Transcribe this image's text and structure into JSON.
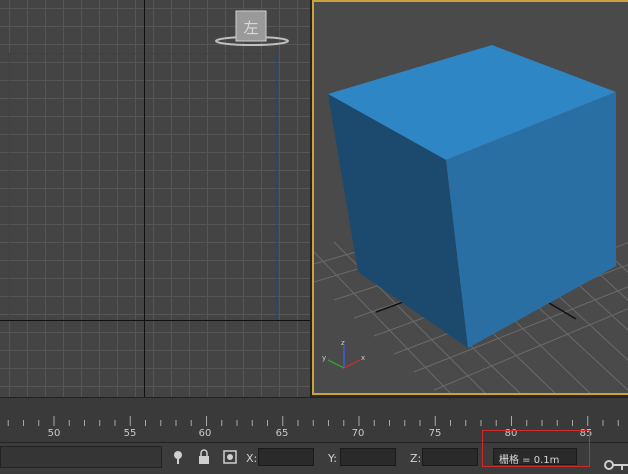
{
  "timeline": {
    "labels": [
      "50",
      "55",
      "60",
      "65",
      "70",
      "75",
      "80",
      "85"
    ]
  },
  "viewcube": {
    "face_label": "左"
  },
  "statusbar": {
    "x_label": "X:",
    "y_label": "Y:",
    "z_label": "Z:",
    "x_value": "",
    "y_value": "",
    "z_value": "",
    "grid_text": "栅格 = 0.1m"
  },
  "colors": {
    "cube_front": "#1b4a6e",
    "cube_top": "#2f86c4",
    "cube_side": "#2a6fa3",
    "active_viewport_border": "#c8a43a",
    "highlight_box": "#d02a2a"
  }
}
